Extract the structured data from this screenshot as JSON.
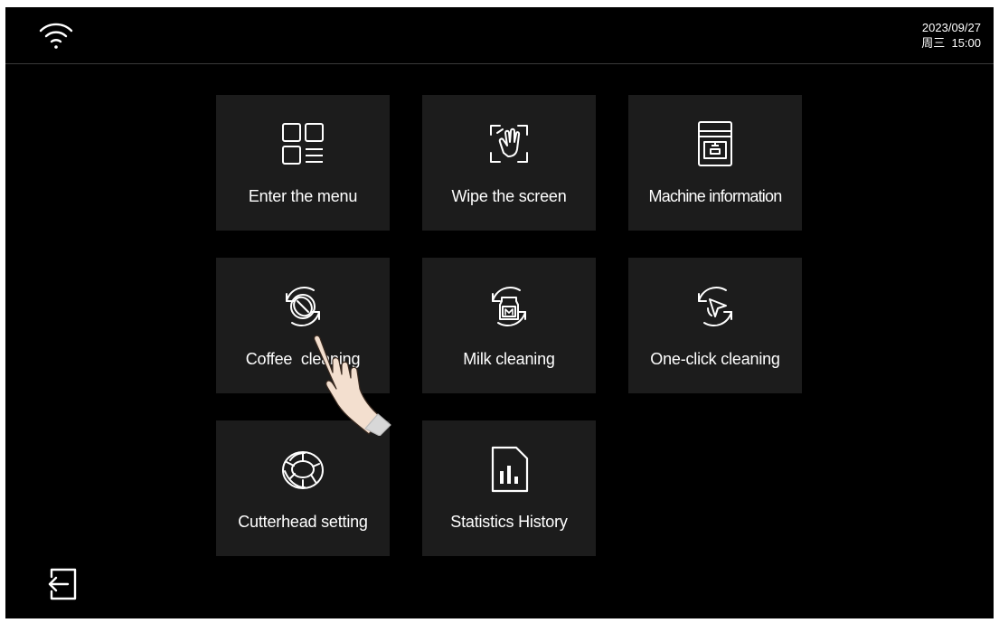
{
  "status": {
    "wifi_icon": "wifi-icon",
    "date": "2023/09/27",
    "weekday_time": "周三  15:00"
  },
  "tiles": [
    {
      "label": "Enter the menu",
      "icon": "menu-grid-icon"
    },
    {
      "label": "Wipe the screen",
      "icon": "wipe-hand-icon"
    },
    {
      "label": "Machine information",
      "icon": "coffee-machine-icon"
    },
    {
      "label": "Coffee  cleaning",
      "icon": "coffee-bean-refresh-icon"
    },
    {
      "label": "Milk cleaning",
      "icon": "milk-refresh-icon"
    },
    {
      "label": "One-click cleaning",
      "icon": "cursor-refresh-icon"
    },
    {
      "label": "Cutterhead setting",
      "icon": "grinder-burr-icon"
    },
    {
      "label": "Statistics History",
      "icon": "statistics-document-icon"
    }
  ],
  "footer": {
    "exit_icon": "exit-icon"
  },
  "overlay": {
    "pointer_icon": "hand-pointer-icon"
  },
  "colors": {
    "background": "#000000",
    "tile": "#1c1c1c",
    "text": "#ffffff"
  }
}
